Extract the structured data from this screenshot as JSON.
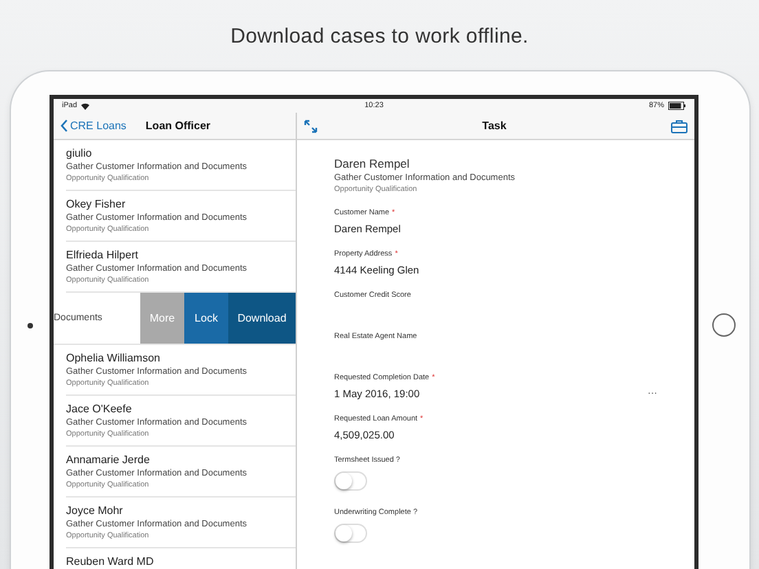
{
  "headline": "Download cases to work offline.",
  "status_bar": {
    "device": "iPad",
    "time": "10:23",
    "battery": "87%"
  },
  "master": {
    "back": "CRE Loans",
    "title": "Loan Officer",
    "items": [
      {
        "kind": "case",
        "name": "giulio",
        "task": "Gather Customer Information and Documents",
        "stage": "Opportunity Qualification"
      },
      {
        "kind": "case",
        "name": "Okey Fisher",
        "task": "Gather Customer Information and Documents",
        "stage": "Opportunity Qualification"
      },
      {
        "kind": "case",
        "name": "Elfrieda Hilpert",
        "task": "Gather Customer Information and Documents",
        "stage": "Opportunity Qualification"
      },
      {
        "kind": "swiped",
        "visible_text": "Documents",
        "actions": [
          {
            "label": "More",
            "color": "#a9a9a9"
          },
          {
            "label": "Lock",
            "color": "#1a6aa6"
          },
          {
            "label": "Download",
            "color": "#0e5685"
          }
        ]
      },
      {
        "kind": "case",
        "name": "Ophelia Williamson",
        "task": "Gather Customer Information and Documents",
        "stage": "Opportunity Qualification"
      },
      {
        "kind": "case",
        "name": "Jace O'Keefe",
        "task": "Gather Customer Information and Documents",
        "stage": "Opportunity Qualification"
      },
      {
        "kind": "case",
        "name": "Annamarie Jerde",
        "task": "Gather Customer Information and Documents",
        "stage": "Opportunity Qualification"
      },
      {
        "kind": "case",
        "name": "Joyce Mohr",
        "task": "Gather Customer Information and Documents",
        "stage": "Opportunity Qualification"
      },
      {
        "kind": "case",
        "name": "Reuben Ward MD"
      }
    ]
  },
  "detail": {
    "title": "Task",
    "required_symbol": "*",
    "name": "Daren Rempel",
    "task": "Gather Customer Information and Documents",
    "stage": "Opportunity Qualification",
    "fields": [
      {
        "kind": "text",
        "label": "Customer Name",
        "required": true,
        "value": "Daren Rempel"
      },
      {
        "kind": "text",
        "label": "Property Address",
        "required": true,
        "value": "4144 Keeling Glen"
      },
      {
        "kind": "text",
        "label": "Customer Credit Score",
        "required": false
      },
      {
        "kind": "text",
        "label": "Real Estate Agent Name",
        "required": false
      },
      {
        "kind": "date",
        "label": "Requested Completion Date",
        "required": true,
        "value": "1 May 2016, 19:00",
        "more": "···"
      },
      {
        "kind": "text",
        "label": "Requested Loan Amount",
        "required": true,
        "value": "4,509,025.00"
      },
      {
        "kind": "switch",
        "label": "Termsheet Issued ?",
        "on": false
      },
      {
        "kind": "switch",
        "label": "Underwriting Complete ?",
        "on": false
      }
    ]
  }
}
